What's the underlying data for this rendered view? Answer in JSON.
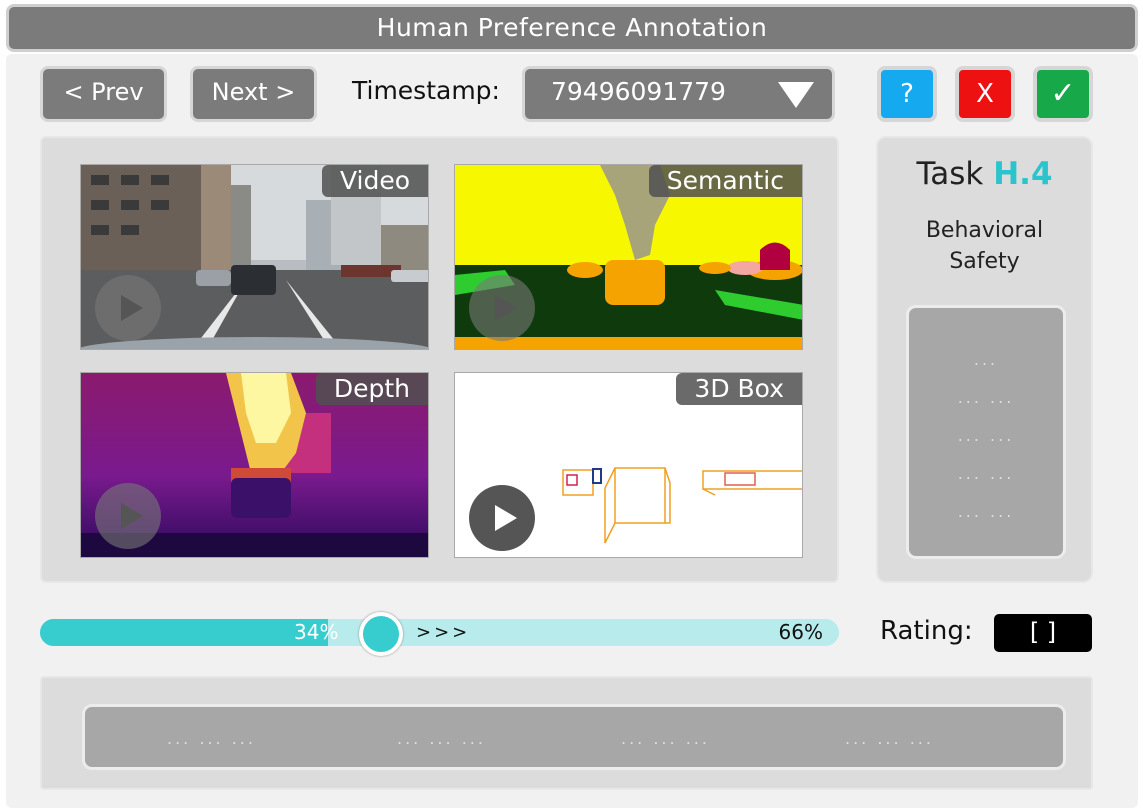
{
  "window": {
    "title": "Human Preference Annotation"
  },
  "toolbar": {
    "prev_label": "< Prev",
    "next_label": "Next >",
    "timestamp_label": "Timestamp:",
    "timestamp_value": "79496091779",
    "help_label": "?",
    "reject_label": "X",
    "accept_label": "✓"
  },
  "views": [
    {
      "label": "Video"
    },
    {
      "label": "Semantic"
    },
    {
      "label": "Depth"
    },
    {
      "label": "3D Box"
    }
  ],
  "task": {
    "prefix": "Task",
    "id": "H.4",
    "line1": "Behavioral",
    "line2": "Safety",
    "placeholder_rows": [
      "...",
      "...   ...",
      "...   ...",
      "...   ...",
      "...   ..."
    ]
  },
  "slider": {
    "left_label": "34%",
    "right_label": "66%",
    "arrows": ">>>",
    "position_percent": 34
  },
  "rating": {
    "label": "Rating:",
    "value": "[    ]"
  },
  "bottom": {
    "placeholder_groups": [
      "...   ...   ...",
      "...   ...   ...",
      "...   ...   ...",
      "...   ...   ..."
    ]
  },
  "colors": {
    "accent": "#37cdcf",
    "help": "#15aaf0",
    "reject": "#ee1111",
    "accept": "#17a84a",
    "task_id": "#2cc4cc"
  }
}
